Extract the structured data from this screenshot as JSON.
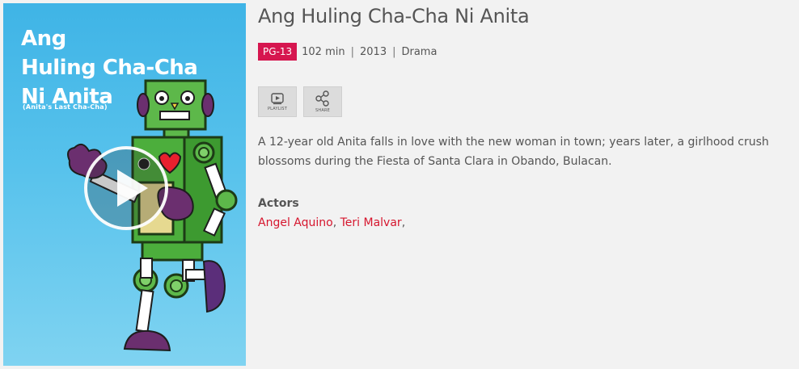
{
  "poster": {
    "title_lines": [
      "Ang",
      "Huling Cha-Cha",
      "Ni Anita"
    ],
    "subtitle": "(Anita's Last Cha-Cha)",
    "play_icon": "play-icon"
  },
  "movie": {
    "title": "Ang Huling Cha-Cha Ni Anita",
    "rating": "PG-13",
    "duration": "102 min",
    "year": "2013",
    "genre": "Drama",
    "separator": "|",
    "description": "A 12-year old Anita falls in love with the new woman in town; years later, a girlhood crush blossoms during the Fiesta of Santa Clara in Obando, Bulacan.",
    "actors_heading": "Actors",
    "actors": [
      "Angel Aquino",
      "Teri Malvar"
    ],
    "actor_suffix": ","
  },
  "actions": {
    "playlist_label": "PLAYLIST",
    "share_label": "SHARE",
    "playlist_icon": "playlist-icon",
    "share_icon": "share-icon"
  },
  "colors": {
    "rating_bg": "#d6164f",
    "actor_link": "#d6162e",
    "poster_bg": "#3fb4e6",
    "robot_green": "#4cae3c"
  }
}
